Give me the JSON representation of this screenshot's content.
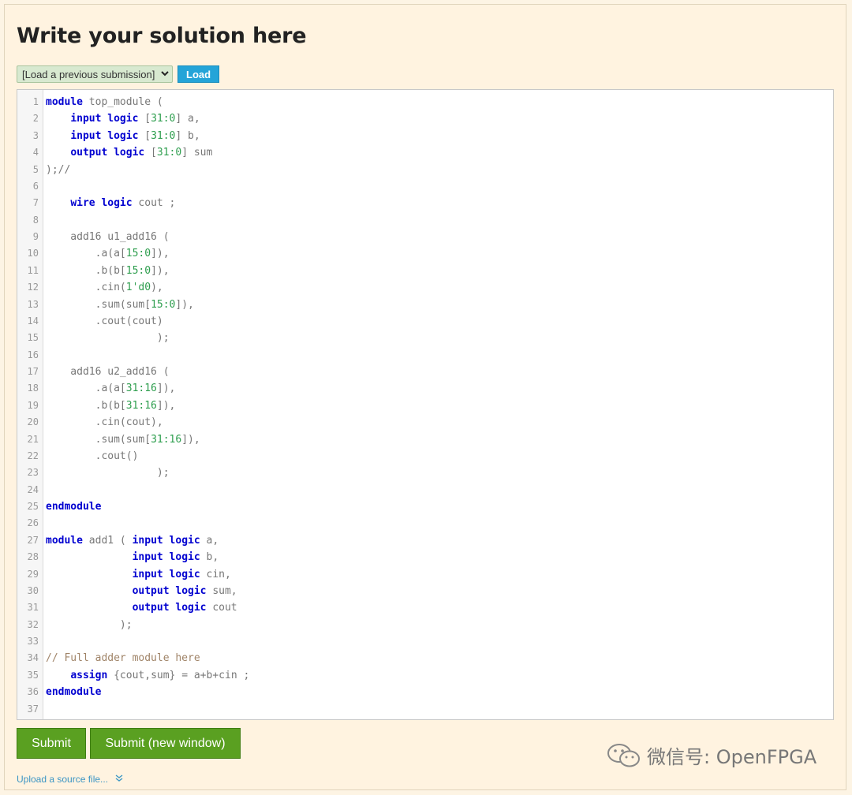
{
  "page": {
    "title": "Write your solution here",
    "load_select": {
      "value": "[Load a previous submission]"
    },
    "load_button": "Load",
    "submit_button": "Submit",
    "submit_new_window_button": "Submit (new window)",
    "upload_link": "Upload a source file...",
    "watermark": "微信号: OpenFPGA"
  },
  "colors": {
    "keyword": "#0000d0",
    "number": "#2e9e4e",
    "comment": "#a08468",
    "submit_green": "#5aa021",
    "load_blue": "#24a4d8"
  },
  "editor": {
    "lines": [
      [
        [
          "kw",
          "module"
        ],
        [
          "t",
          " top_module ("
        ]
      ],
      [
        [
          "t",
          "    "
        ],
        [
          "kw",
          "input logic"
        ],
        [
          "t",
          " ["
        ],
        [
          "num",
          "31:0"
        ],
        [
          "t",
          "] a,"
        ]
      ],
      [
        [
          "t",
          "    "
        ],
        [
          "kw",
          "input logic"
        ],
        [
          "t",
          " ["
        ],
        [
          "num",
          "31:0"
        ],
        [
          "t",
          "] b,"
        ]
      ],
      [
        [
          "t",
          "    "
        ],
        [
          "kw",
          "output logic"
        ],
        [
          "t",
          " ["
        ],
        [
          "num",
          "31:0"
        ],
        [
          "t",
          "] sum"
        ]
      ],
      [
        [
          "t",
          ");//"
        ]
      ],
      [],
      [
        [
          "t",
          "    "
        ],
        [
          "kw",
          "wire logic"
        ],
        [
          "t",
          " cout ;"
        ]
      ],
      [],
      [
        [
          "t",
          "    add16 u1_add16 ("
        ]
      ],
      [
        [
          "t",
          "        .a(a["
        ],
        [
          "num",
          "15:0"
        ],
        [
          "t",
          "]),"
        ]
      ],
      [
        [
          "t",
          "        .b(b["
        ],
        [
          "num",
          "15:0"
        ],
        [
          "t",
          "]),"
        ]
      ],
      [
        [
          "t",
          "        .cin("
        ],
        [
          "num",
          "1'd0"
        ],
        [
          "t",
          "),"
        ]
      ],
      [
        [
          "t",
          "        .sum(sum["
        ],
        [
          "num",
          "15:0"
        ],
        [
          "t",
          "]),"
        ]
      ],
      [
        [
          "t",
          "        .cout(cout)"
        ]
      ],
      [
        [
          "t",
          "                  );"
        ]
      ],
      [],
      [
        [
          "t",
          "    add16 u2_add16 ("
        ]
      ],
      [
        [
          "t",
          "        .a(a["
        ],
        [
          "num",
          "31:16"
        ],
        [
          "t",
          "]),"
        ]
      ],
      [
        [
          "t",
          "        .b(b["
        ],
        [
          "num",
          "31:16"
        ],
        [
          "t",
          "]),"
        ]
      ],
      [
        [
          "t",
          "        .cin(cout),"
        ]
      ],
      [
        [
          "t",
          "        .sum(sum["
        ],
        [
          "num",
          "31:16"
        ],
        [
          "t",
          "]),"
        ]
      ],
      [
        [
          "t",
          "        .cout()"
        ]
      ],
      [
        [
          "t",
          "                  );"
        ]
      ],
      [],
      [
        [
          "kw",
          "endmodule"
        ]
      ],
      [],
      [
        [
          "kw",
          "module"
        ],
        [
          "t",
          " add1 ( "
        ],
        [
          "kw",
          "input logic"
        ],
        [
          "t",
          " a,"
        ]
      ],
      [
        [
          "t",
          "              "
        ],
        [
          "kw",
          "input logic"
        ],
        [
          "t",
          " b,"
        ]
      ],
      [
        [
          "t",
          "              "
        ],
        [
          "kw",
          "input logic"
        ],
        [
          "t",
          " cin,"
        ]
      ],
      [
        [
          "t",
          "              "
        ],
        [
          "kw",
          "output logic"
        ],
        [
          "t",
          " sum,"
        ]
      ],
      [
        [
          "t",
          "              "
        ],
        [
          "kw",
          "output logic"
        ],
        [
          "t",
          " cout"
        ]
      ],
      [
        [
          "t",
          "            );"
        ]
      ],
      [],
      [
        [
          "cm",
          "// Full adder module here"
        ]
      ],
      [
        [
          "t",
          "    "
        ],
        [
          "kw",
          "assign"
        ],
        [
          "t",
          " {cout,sum} = a+b+cin ;"
        ]
      ],
      [
        [
          "kw",
          "endmodule"
        ]
      ],
      []
    ]
  }
}
